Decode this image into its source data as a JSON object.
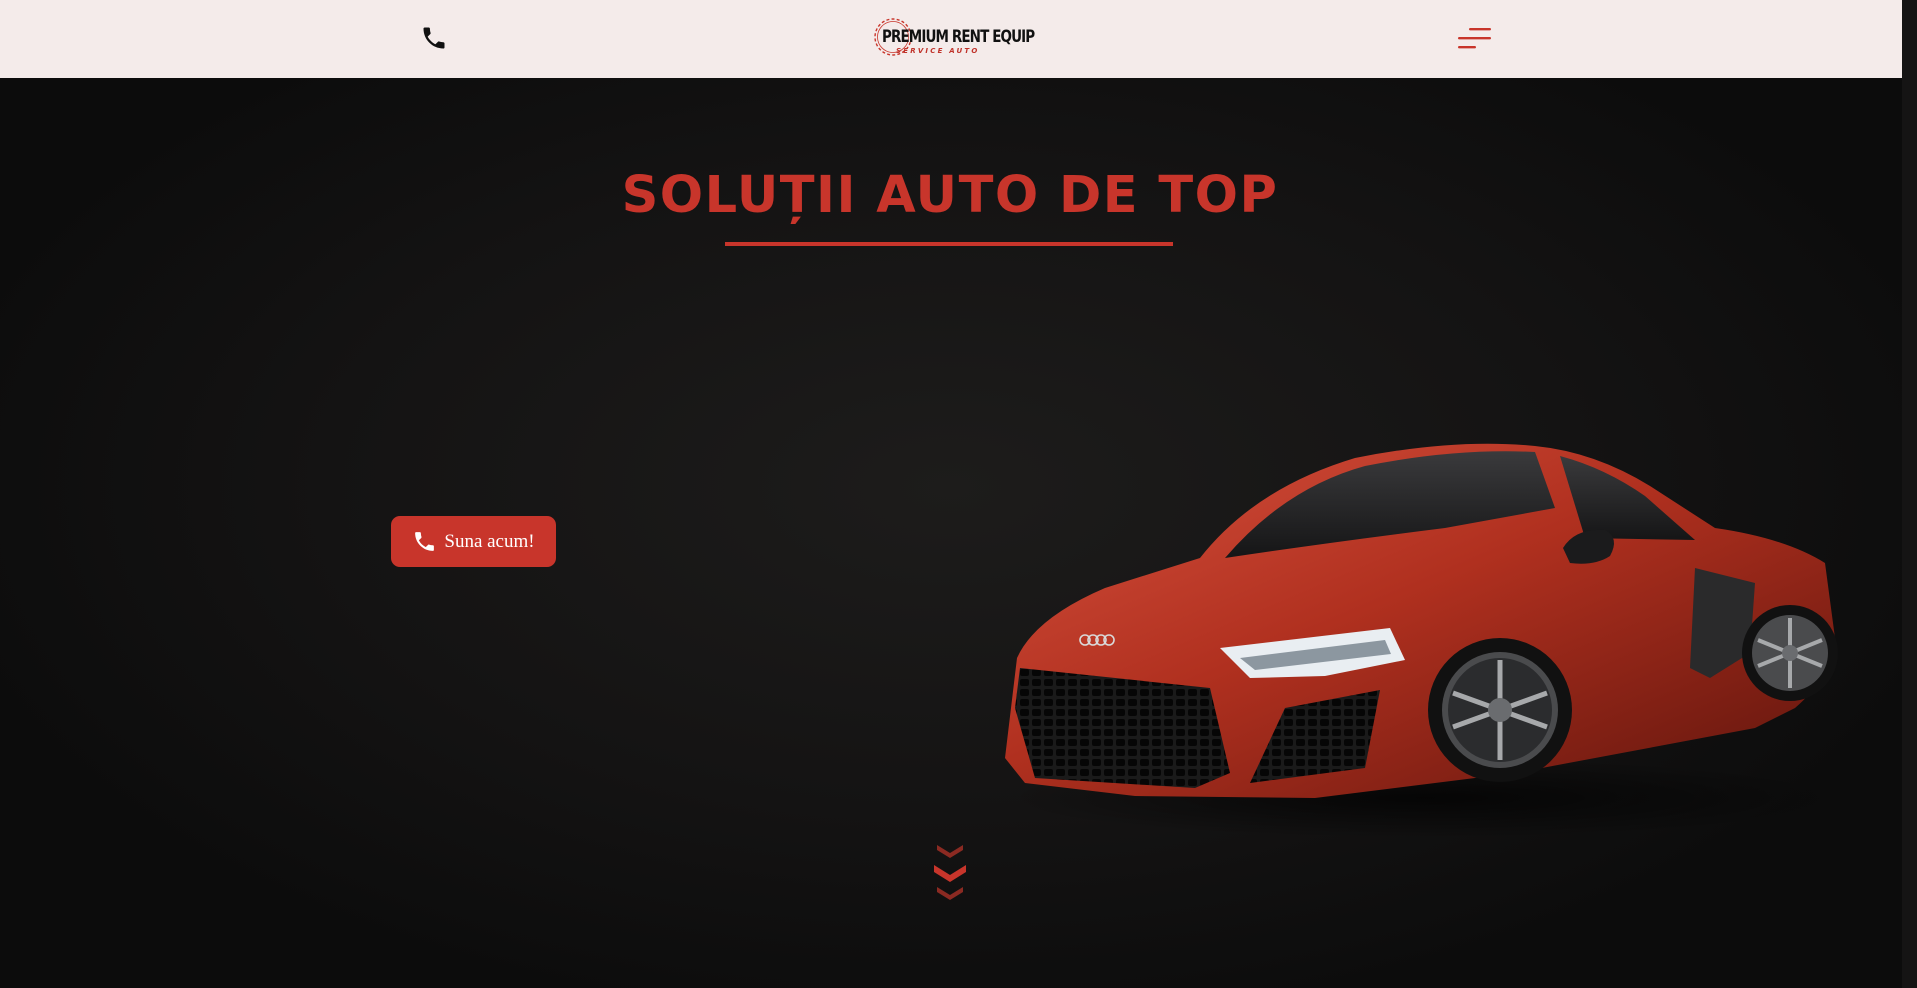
{
  "header": {
    "phone_icon": "phone-icon",
    "logo": {
      "brand": "PREMIUM RENT EQUIP",
      "subtitle": "SERVICE AUTO"
    },
    "menu_icon": "hamburger-menu-icon"
  },
  "hero": {
    "title": "SOLUȚII AUTO DE TOP",
    "cta": {
      "icon": "phone-icon",
      "label": "Suna acum!"
    },
    "image": "red-sports-car",
    "scroll_icon": "chevrons-down-icon"
  },
  "colors": {
    "accent": "#c8352b",
    "header_bg": "#f4ebea",
    "hero_bg": "#151414",
    "button_text": "#ffffff"
  }
}
